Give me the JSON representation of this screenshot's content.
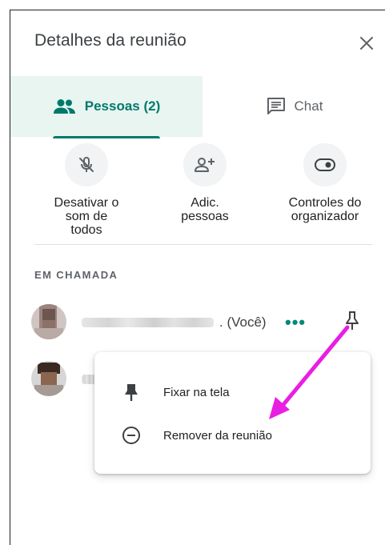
{
  "header": {
    "title": "Detalhes da reunião",
    "close_icon": "close-icon"
  },
  "tabs": [
    {
      "label": "Pessoas (2)",
      "icon": "people-icon",
      "active": true
    },
    {
      "label": "Chat",
      "icon": "chat-icon",
      "active": false
    }
  ],
  "actions": [
    {
      "label": "Desativar o\nsom de\ntodos",
      "icon": "mic-off-icon"
    },
    {
      "label": "Adic.\npessoas",
      "icon": "add-person-icon"
    },
    {
      "label": "Controles do\norganizador",
      "icon": "toggle-icon"
    }
  ],
  "section": {
    "title": "EM CHAMADA"
  },
  "participants": [
    {
      "name_suffix": ". (Você)",
      "more_label": "•••",
      "pin_icon": "pin-icon"
    },
    {
      "name_suffix": ""
    }
  ],
  "context_menu": {
    "items": [
      {
        "label": "Fixar na tela",
        "icon": "pin-icon"
      },
      {
        "label": "Remover da reunião",
        "icon": "remove-circle-icon"
      }
    ]
  },
  "colors": {
    "accent": "#00796b",
    "tab_bg": "#e8f5f1",
    "annotation_arrow": "#e91ee3"
  }
}
